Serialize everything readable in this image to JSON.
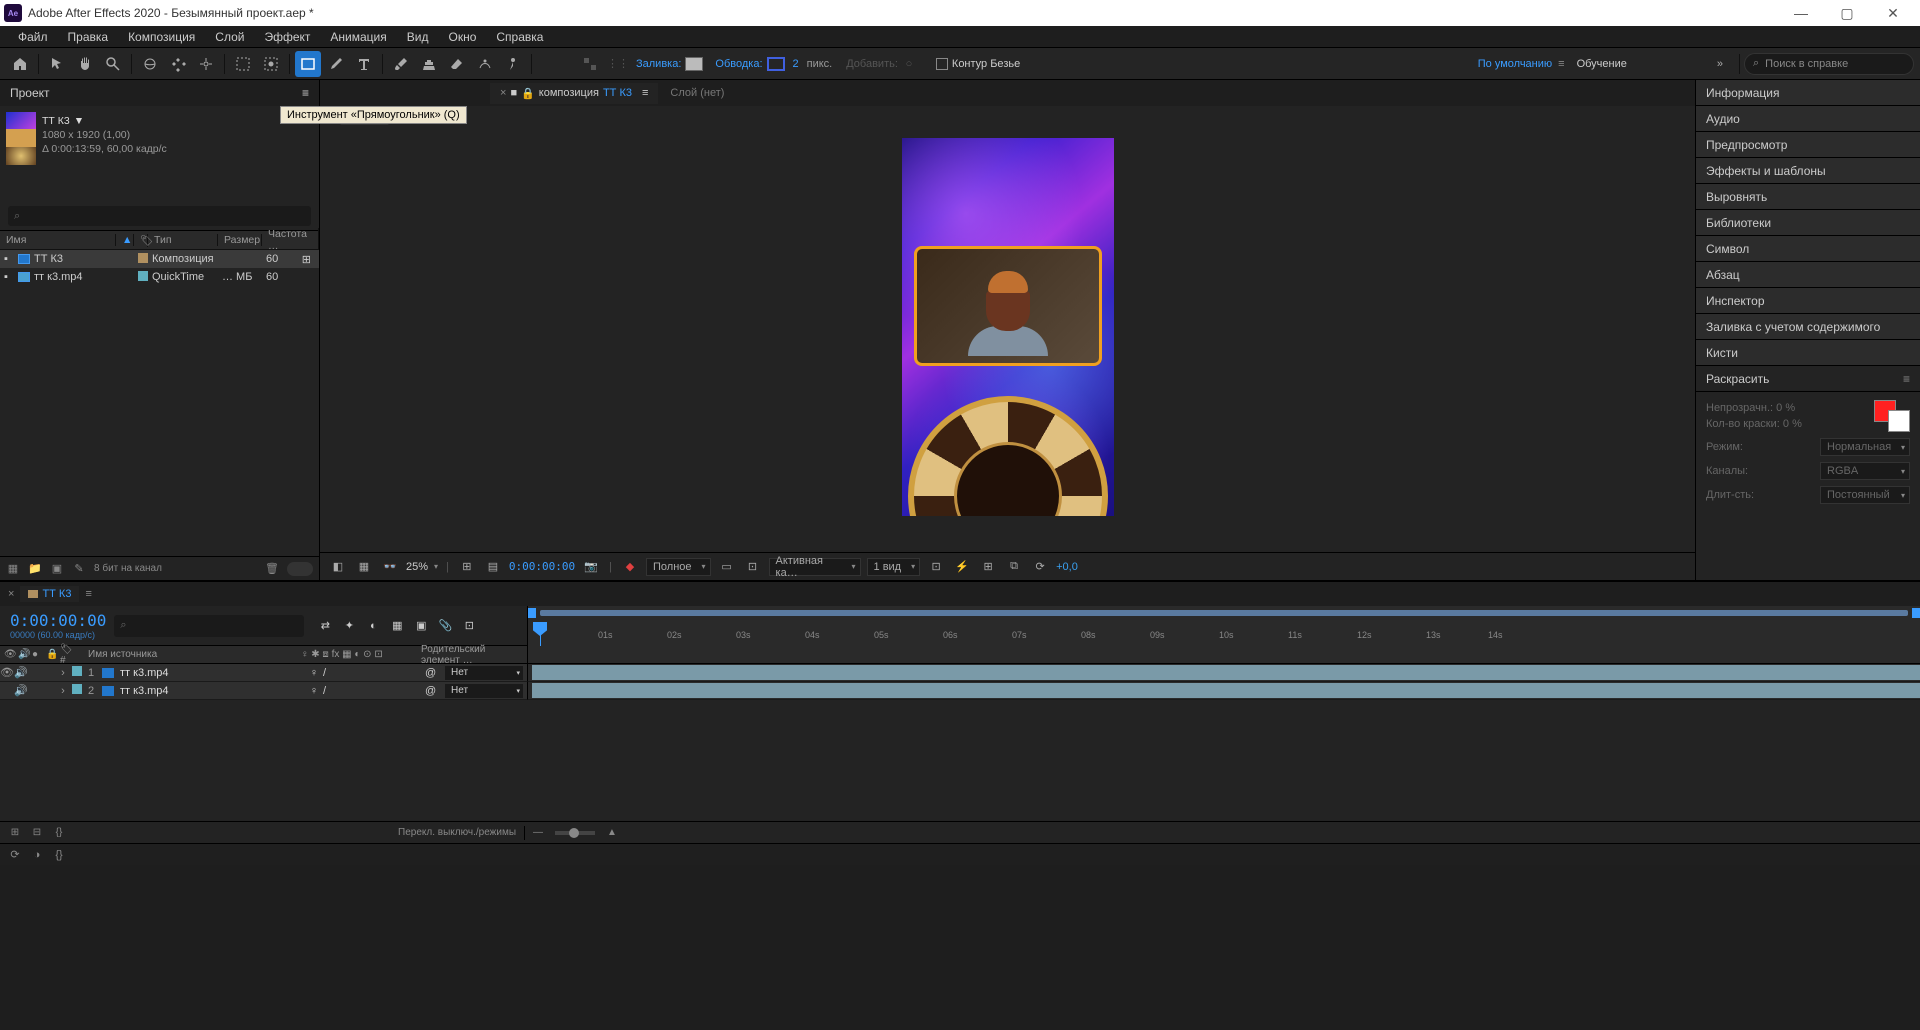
{
  "titlebar": {
    "app_icon": "Ae",
    "title": "Adobe After Effects 2020 - Безымянный проект.aep *"
  },
  "menu": [
    "Файл",
    "Правка",
    "Композиция",
    "Слой",
    "Эффект",
    "Анимация",
    "Вид",
    "Окно",
    "Справка"
  ],
  "toolbar": {
    "fill_label": "Заливка:",
    "stroke_label": "Обводка:",
    "stroke_width": "2",
    "stroke_unit": "пикс.",
    "add_label": "Добавить:",
    "bezier_label": "Контур Безье",
    "workspace": "По умолчанию",
    "learn": "Обучение",
    "search_placeholder": "Поиск в справке",
    "tooltip": "Инструмент «Прямоугольник» (Q)"
  },
  "project": {
    "tab": "Проект",
    "comp_name": "ТТ К3",
    "dims": "1080 x 1920 (1,00)",
    "duration": "Δ 0:00:13:59, 60,00 кадр/с",
    "cols": {
      "name": "Имя",
      "type": "Тип",
      "size": "Размер",
      "rate": "Частота …"
    },
    "items": [
      {
        "name": "ТТ К3",
        "type": "Композиция",
        "size": "",
        "rate": "60"
      },
      {
        "name": "тт к3.mp4",
        "type": "QuickTime",
        "size": "… МБ",
        "rate": "60"
      }
    ],
    "bpc": "8 бит на канал"
  },
  "viewer": {
    "tab_prefix": "композиция",
    "tab_name": "ТТ К3",
    "layer_none": "Слой  (нет)",
    "breadcrumb": "ТТ К3",
    "zoom": "25%",
    "timecode": "0:00:00:00",
    "resolution": "Полное",
    "camera": "Активная ка…",
    "views": "1 вид",
    "exposure": "+0,0"
  },
  "right_panels": {
    "items": [
      "Информация",
      "Аудио",
      "Предпросмотр",
      "Эффекты и шаблоны",
      "Выровнять",
      "Библиотеки",
      "Символ",
      "Абзац",
      "Инспектор",
      "Заливка с учетом содержимого",
      "Кисти"
    ],
    "paint_title": "Раскрасить",
    "paint": {
      "opacity_label": "Непрозрачн.:",
      "opacity_val": "0 %",
      "flow_label": "Кол-во краски:",
      "flow_val": "0 %",
      "mode_label": "Режим:",
      "mode_val": "Нормальная",
      "channels_label": "Каналы:",
      "channels_val": "RGBA",
      "duration_label": "Длит-сть:",
      "duration_val": "Постоянный"
    }
  },
  "timeline": {
    "tab": "ТТ К3",
    "timecode": "0:00:00:00",
    "frame_info": "00000 (60.00 кадр/с)",
    "cols": {
      "source": "Имя источника",
      "parent": "Родительский элемент …",
      "none": "Нет"
    },
    "layers": [
      {
        "num": "1",
        "name": "тт к3.mp4"
      },
      {
        "num": "2",
        "name": "тт к3.mp4"
      }
    ],
    "ruler": [
      "01s",
      "02s",
      "03s",
      "04s",
      "05s",
      "06s",
      "07s",
      "08s",
      "09s",
      "10s",
      "11s",
      "12s",
      "13s",
      "14s"
    ],
    "footer_text": "Перекл. выключ./режимы"
  }
}
